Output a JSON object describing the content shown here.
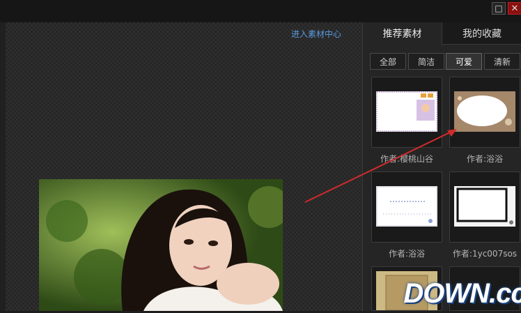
{
  "window": {
    "maximize_glyph": "□",
    "close_glyph": "✕"
  },
  "canvas": {
    "enter_link": "进入素材中心"
  },
  "sidebar": {
    "tabs": [
      {
        "label": "推荐素材"
      },
      {
        "label": "我的收藏"
      }
    ],
    "subtabs": [
      {
        "label": "全部"
      },
      {
        "label": "简洁"
      },
      {
        "label": "可爱"
      },
      {
        "label": "清新"
      }
    ],
    "items": [
      {
        "author": "作者:樱桃山谷"
      },
      {
        "author": "作者:浴浴"
      },
      {
        "author": "作者:浴浴"
      },
      {
        "author": "作者:1yc007sos"
      }
    ]
  },
  "watermark": "DOWN.cc",
  "colors": {
    "accent_link": "#5a9be0",
    "arrow": "#d12b2b",
    "close_button": "#8b1010"
  }
}
